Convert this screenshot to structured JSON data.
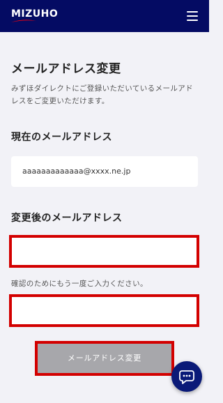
{
  "header": {
    "logo_text": "MIZUHO",
    "brand_color": "#040b63",
    "accent_color": "#d30000",
    "menu_icon": "hamburger-menu-icon"
  },
  "main": {
    "title": "メールアドレス変更",
    "description": "みずほダイレクトにご登録いただいているメールアドレスをご変更いただけます。",
    "current_email_label": "現在のメールアドレス",
    "current_email_value": "aaaaaaaaaaaaa@xxxx.ne.jp",
    "new_email_label": "変更後のメールアドレス",
    "new_email_value": "",
    "confirm_hint": "確認のためにもう一度ご入力ください。",
    "confirm_email_value": "",
    "submit_label": "メールアドレス変更"
  },
  "chat": {
    "icon": "chat-bubble-icon"
  }
}
